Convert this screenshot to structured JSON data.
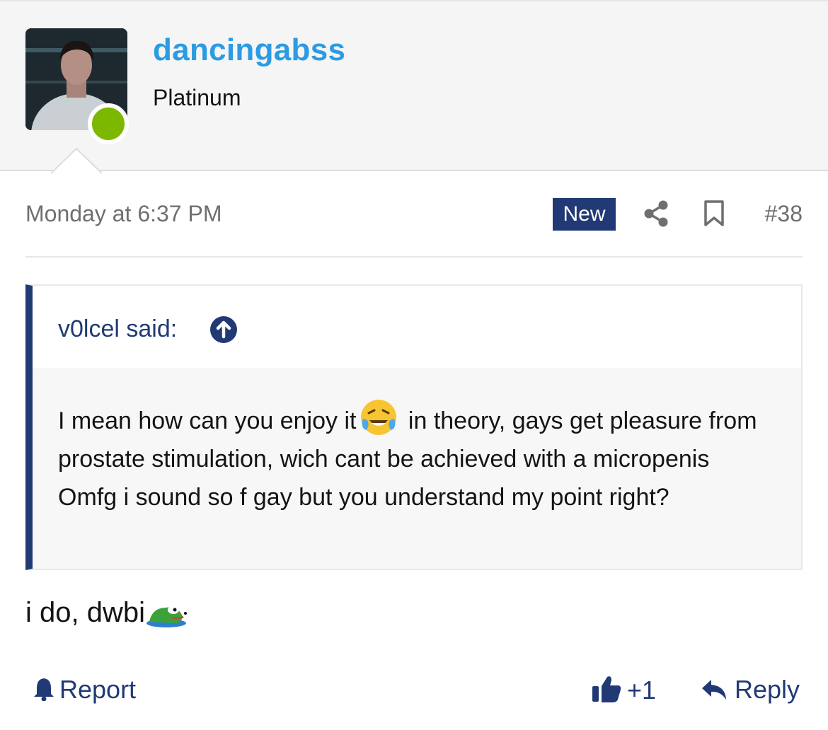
{
  "user": {
    "username": "dancingabss",
    "title": "Platinum",
    "online_color": "#7cb800",
    "avatar_icon": "user-avatar-photo"
  },
  "post": {
    "date": "Monday at 6:37 PM",
    "badge": "New",
    "number": "#38",
    "icons": [
      "share-icon",
      "bookmark-icon"
    ]
  },
  "quote": {
    "author_label": "v0lcel said:",
    "body_before_emoji": "I mean how can you enjoy it",
    "emoji": "face-with-tears-of-joy",
    "body_after_emoji": " in theory, gays get pleasure from prostate stimulation, wich cant be achieved with a micropenis",
    "body_line2": "Omfg i sound so f gay but you understand my point right?"
  },
  "reply": {
    "text": "i do, dwbi",
    "emoji": "pepe-frog"
  },
  "actions": {
    "report_label": "Report",
    "like_count": "+1",
    "reply_label": "Reply"
  },
  "colors": {
    "username": "#2b9be4",
    "navy": "#213a75",
    "header_bg": "#f5f5f5",
    "quote_bg": "#f7f7f7"
  }
}
